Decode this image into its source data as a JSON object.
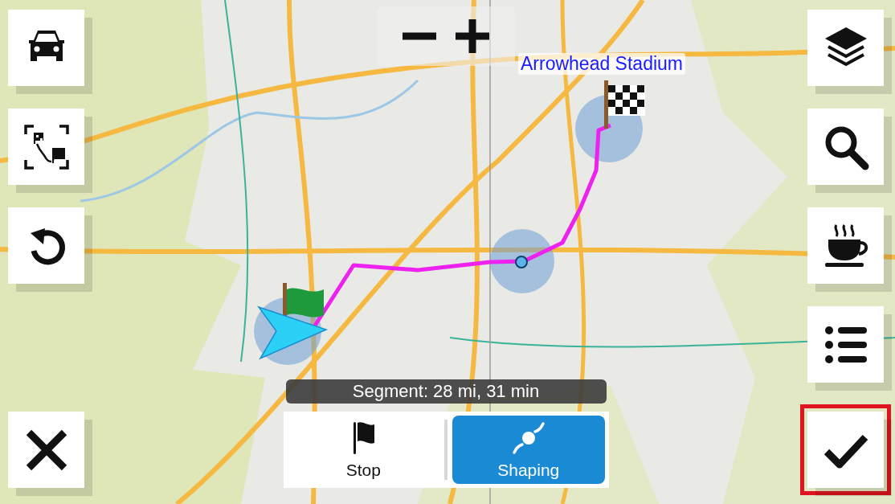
{
  "map": {
    "kind": "picture",
    "destination_label": "Arrowhead Stadium"
  },
  "zoom_buttons": [
    {
      "kind": "zoom-out"
    },
    {
      "kind": "zoom-in"
    }
  ],
  "left_buttons": [
    {
      "kind": "vehicle"
    },
    {
      "kind": "fit-route"
    },
    {
      "kind": "undo"
    }
  ],
  "cancel_button": {
    "kind": "cancel"
  },
  "right_buttons": [
    {
      "kind": "layers"
    },
    {
      "kind": "search"
    },
    {
      "kind": "coffee"
    },
    {
      "kind": "list"
    }
  ],
  "confirm_button": {
    "kind": "confirm",
    "highlighted": true
  },
  "segment_info": "Segment: 28 mi, 31 min",
  "point_types": [
    {
      "label": "Stop",
      "kind": "stop",
      "selected": false
    },
    {
      "label": "Shaping",
      "kind": "shaping",
      "selected": true
    }
  ]
}
